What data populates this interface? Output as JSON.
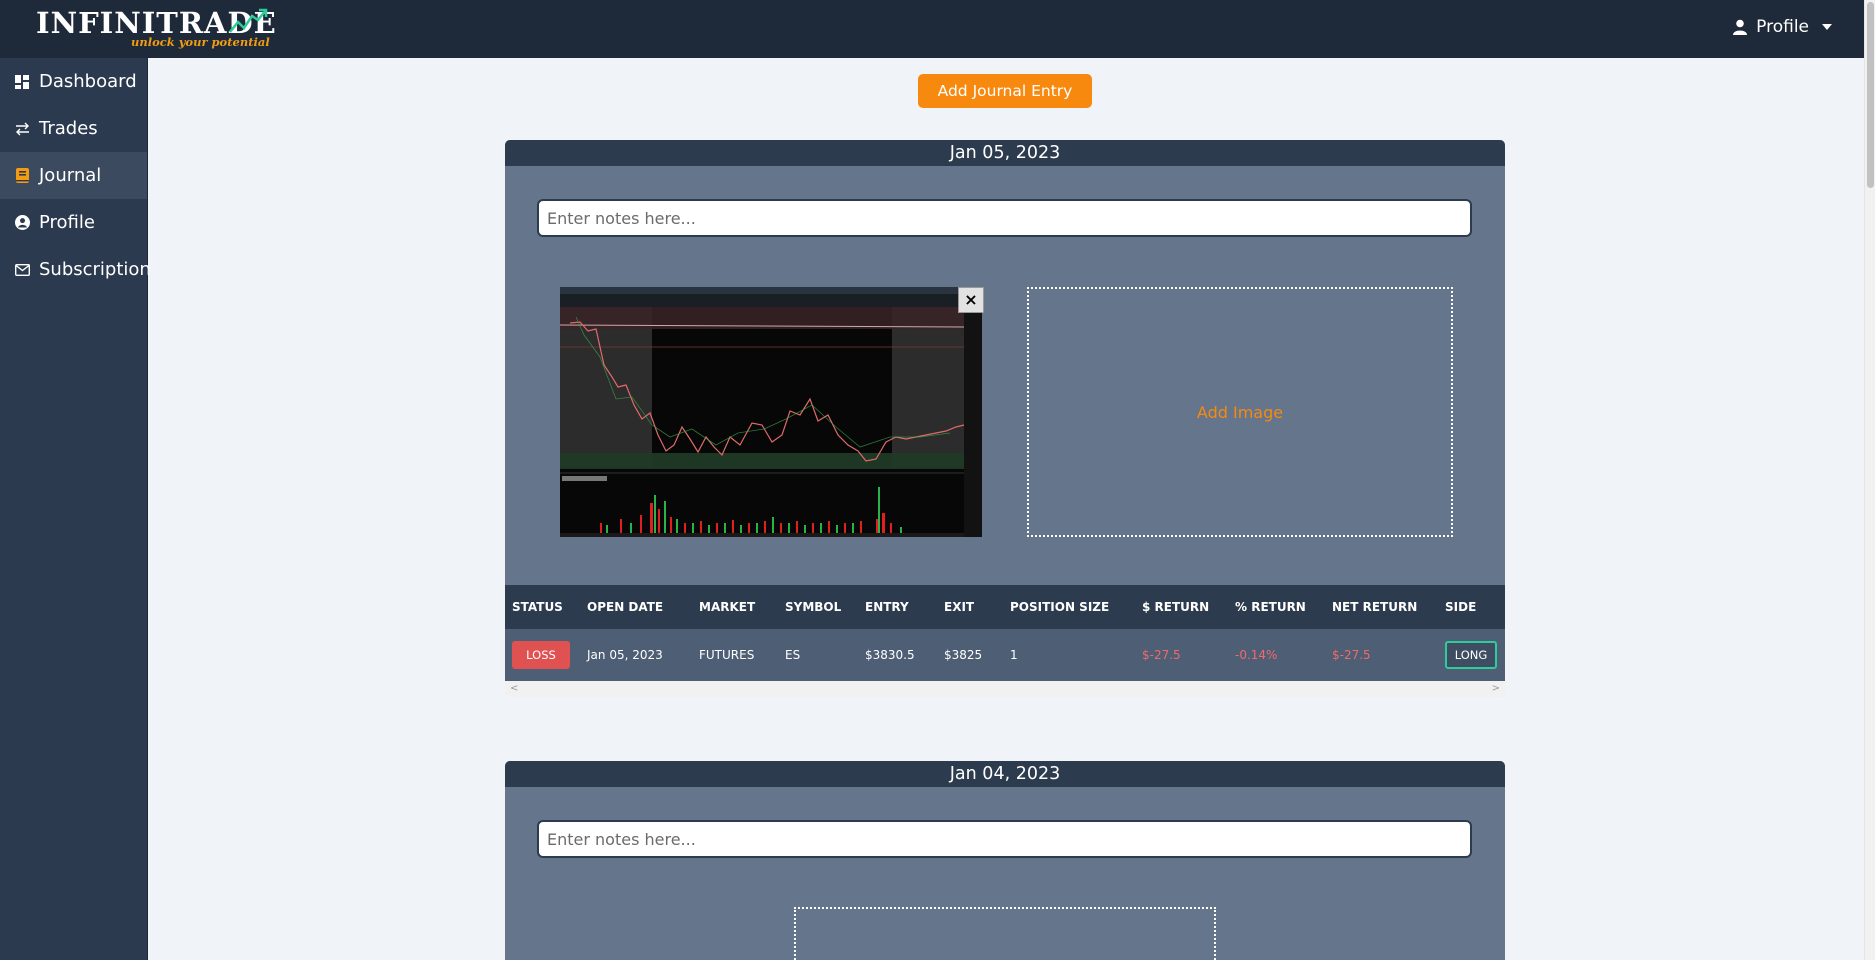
{
  "app": {
    "brand": "INFINITRADE",
    "tagline": "unlock your potential",
    "profile_menu_label": "Profile"
  },
  "sidebar": {
    "items": [
      {
        "label": "Dashboard",
        "icon": "dashboard-icon"
      },
      {
        "label": "Trades",
        "icon": "arrows-exchange-icon"
      },
      {
        "label": "Journal",
        "icon": "book-icon",
        "active": true
      },
      {
        "label": "Profile",
        "icon": "user-circle-icon"
      },
      {
        "label": "Subscription",
        "icon": "envelope-icon"
      }
    ]
  },
  "main": {
    "add_entry_label": "Add Journal Entry",
    "notes_placeholder": "Enter notes here...",
    "add_image_label": "Add Image",
    "close_label": "×",
    "entries": [
      {
        "date": "Jan 05, 2023"
      },
      {
        "date": "Jan 04, 2023"
      }
    ],
    "table": {
      "headers": [
        "STATUS",
        "OPEN DATE",
        "MARKET",
        "SYMBOL",
        "ENTRY",
        "EXIT",
        "POSITION SIZE",
        "$ RETURN",
        "% RETURN",
        "NET RETURN",
        "SIDE"
      ],
      "row": {
        "status": "LOSS",
        "open_date": "Jan 05, 2023",
        "market": "FUTURES",
        "symbol": "ES",
        "entry": "$3830.5",
        "exit": "$3825",
        "position_size": "1",
        "dollar_return": "$-27.5",
        "pct_return": "-0.14%",
        "net_return": "$-27.5",
        "side": "LONG"
      },
      "scroll_left": "<",
      "scroll_right": ">"
    }
  },
  "colors": {
    "topbar": "#1e2a3a",
    "sidebar": "#2b3a4f",
    "accent": "#f7890f",
    "card": "#65758b",
    "loss": "#e05252",
    "long": "#2ecc9a"
  }
}
